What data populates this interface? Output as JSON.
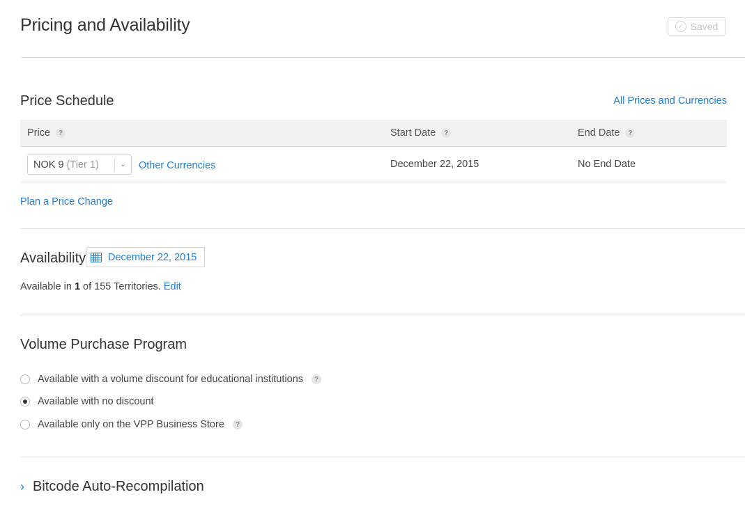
{
  "header": {
    "title": "Pricing and Availability",
    "saved_label": "Saved"
  },
  "price_schedule": {
    "title": "Price Schedule",
    "all_prices_link": "All Prices and Currencies",
    "columns": {
      "price": "Price",
      "start_date": "Start Date",
      "end_date": "End Date"
    },
    "help_glyph": "?",
    "row": {
      "price_value": "NOK 9",
      "price_tier": "(Tier 1)",
      "other_currencies": "Other Currencies",
      "start_date": "December 22, 2015",
      "end_date": "No End Date"
    },
    "plan_change_link": "Plan a Price Change"
  },
  "availability": {
    "title": "Availability",
    "date": "December 22, 2015",
    "prefix": "Available in",
    "count": "1",
    "suffix": "of 155 Territories.",
    "edit_link": "Edit"
  },
  "vpp": {
    "title": "Volume Purchase Program",
    "options": [
      {
        "label": "Available with a volume discount for educational institutions",
        "selected": false
      },
      {
        "label": "Available with no discount",
        "selected": true
      },
      {
        "label": "Available only on the VPP Business Store",
        "selected": false
      }
    ]
  },
  "bitcode": {
    "title": "Bitcode Auto-Recompilation"
  },
  "colors": {
    "link": "#1f7fd6",
    "divider": "#e1e1e1",
    "header_bg": "#f2f2f2"
  }
}
